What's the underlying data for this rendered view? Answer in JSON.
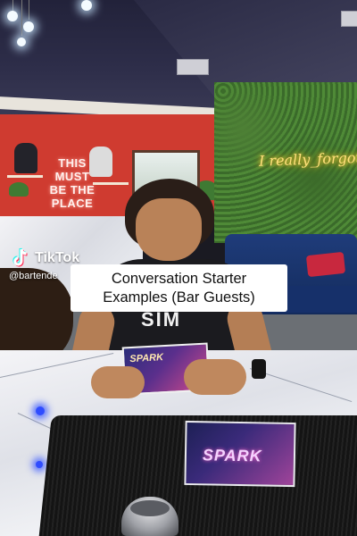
{
  "overlay": {
    "tiktok_wordmark": "TikTok",
    "username": "@bartende",
    "caption": "Conversation Starter\nExamples (Bar Guests)"
  },
  "scene": {
    "neon_sign_text": "THIS\nMUST\nBE THE\nPLACE",
    "neon_script_text": "I really_forgot_here",
    "shirt_text": "SIM",
    "card_held_text": "SPARK",
    "card_table_text": "SPARK"
  },
  "colors": {
    "caption_bg": "#ffffff",
    "tiktok_cyan": "#25f4ee",
    "tiktok_red": "#fe2c55"
  }
}
